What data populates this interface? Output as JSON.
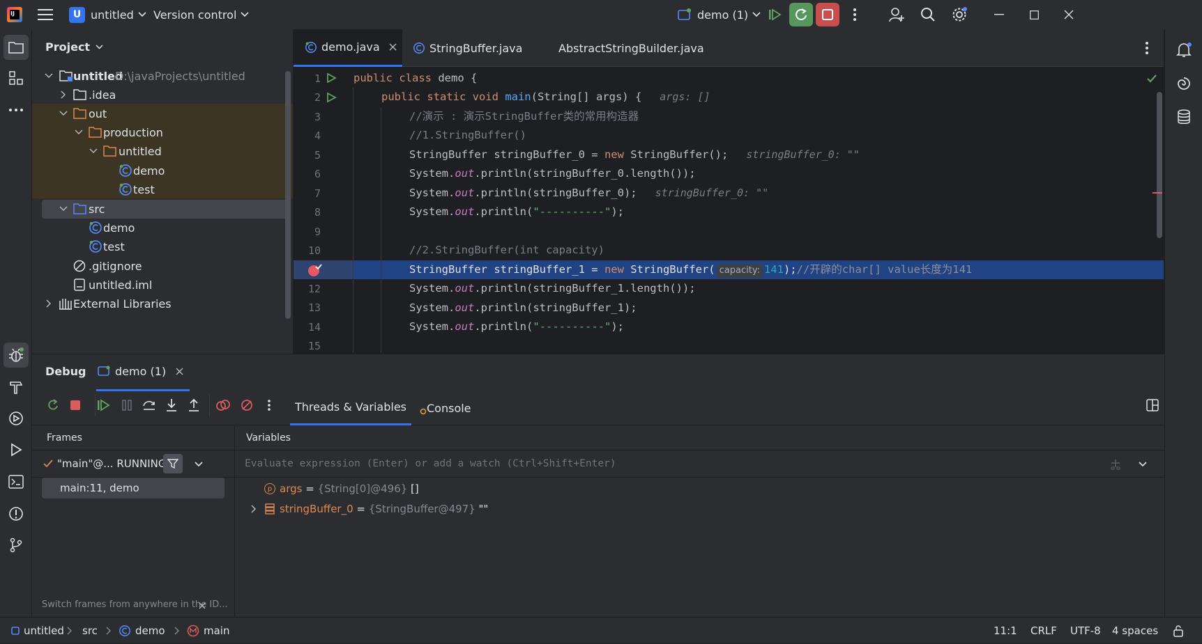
{
  "titlebar": {
    "logo_letter": "IJ",
    "project_badge": "U",
    "project_name": "untitled",
    "vcs_label": "Version control",
    "run_config": "demo (1)"
  },
  "project_panel": {
    "title": "Project",
    "tree": [
      {
        "label": "untitled",
        "path": "D:\\javaProjects\\untitled"
      },
      {
        "label": ".idea"
      },
      {
        "label": "out"
      },
      {
        "label": "production"
      },
      {
        "label": "untitled"
      },
      {
        "label": "demo"
      },
      {
        "label": "test"
      },
      {
        "label": "src"
      },
      {
        "label": "demo"
      },
      {
        "label": "test"
      },
      {
        "label": ".gitignore"
      },
      {
        "label": "untitled.iml"
      },
      {
        "label": "External Libraries"
      }
    ]
  },
  "editor": {
    "tabs": [
      {
        "label": "demo.java",
        "active": true
      },
      {
        "label": "StringBuffer.java",
        "active": false
      },
      {
        "label": "AbstractStringBuilder.java",
        "active": false
      }
    ],
    "line_numbers": [
      "1",
      "2",
      "3",
      "4",
      "5",
      "6",
      "7",
      "8",
      "9",
      "10",
      "",
      "12",
      "13",
      "14",
      "15"
    ],
    "current_line": "11",
    "code": {
      "l1_kw": "public class ",
      "l1_name": "demo {",
      "l2_kw1": "public static void ",
      "l2_fn": "main",
      "l2_rest": "(String[] args) {",
      "l2_hint": "args: []",
      "l3": "//演示 : 演示StringBuffer类的常用构造器",
      "l4": "//1.StringBuffer()",
      "l5_a": "StringBuffer stringBuffer_0 = ",
      "l5_kw": "new ",
      "l5_b": "StringBuffer();",
      "l5_hint": "stringBuffer_0: \"\"",
      "l6_a": "System.",
      "l6_out": "out",
      "l6_b": ".println(stringBuffer_0.length());",
      "l7_a": "System.",
      "l7_out": "out",
      "l7_b": ".println(stringBuffer_0);",
      "l7_hint": "stringBuffer_0: \"\"",
      "l8_a": "System.",
      "l8_out": "out",
      "l8_b": ".println(",
      "l8_str": "\"----------\"",
      "l8_c": ");",
      "l10": "//2.StringBuffer(int capacity)",
      "l11_a": "StringBuffer stringBuffer_1 = ",
      "l11_kw": "new ",
      "l11_b": "StringBuffer(",
      "l11_param": "capacity:",
      "l11_num": "141",
      "l11_c": ");",
      "l11_cm": "//开辟的char[] value长度为141",
      "l12_a": "System.",
      "l12_out": "out",
      "l12_b": ".println(stringBuffer_1.length());",
      "l13_a": "System.",
      "l13_out": "out",
      "l13_b": ".println(stringBuffer_1);",
      "l14_a": "System.",
      "l14_out": "out",
      "l14_b": ".println(",
      "l14_str": "\"----------\"",
      "l14_c": ");"
    }
  },
  "debug": {
    "title": "Debug",
    "session_tab": "demo (1)",
    "tabs": [
      "Threads & Variables",
      "Console"
    ],
    "frames_header": "Frames",
    "variables_header": "Variables",
    "thread_selector": "\"main\"@... RUNNING",
    "frames": [
      "main:11, demo"
    ],
    "eval_placeholder": "Evaluate expression (Enter) or add a watch (Ctrl+Shift+Enter)",
    "variables": [
      {
        "badge": "p",
        "name": "args",
        "eq": " = ",
        "type": "{String[0]@496}",
        "value": " []"
      },
      {
        "badge": "",
        "name": "stringBuffer_0",
        "eq": " = ",
        "type": "{StringBuffer@497}",
        "value": " \"\""
      }
    ],
    "hint": "Switch frames from anywhere in the ID..."
  },
  "statusbar": {
    "crumbs": [
      "untitled",
      "src",
      "demo",
      "main"
    ],
    "position": "11:1",
    "line_sep": "CRLF",
    "encoding": "UTF-8",
    "indent": "4 spaces"
  },
  "colors": {
    "bg_panel": "#2b2d30",
    "bg_editor": "#1e1f22",
    "selection": "#214283",
    "accent_green": "#5fa561",
    "accent_red": "#db5c5c",
    "folder_excluded_bg": "#3d3523"
  }
}
